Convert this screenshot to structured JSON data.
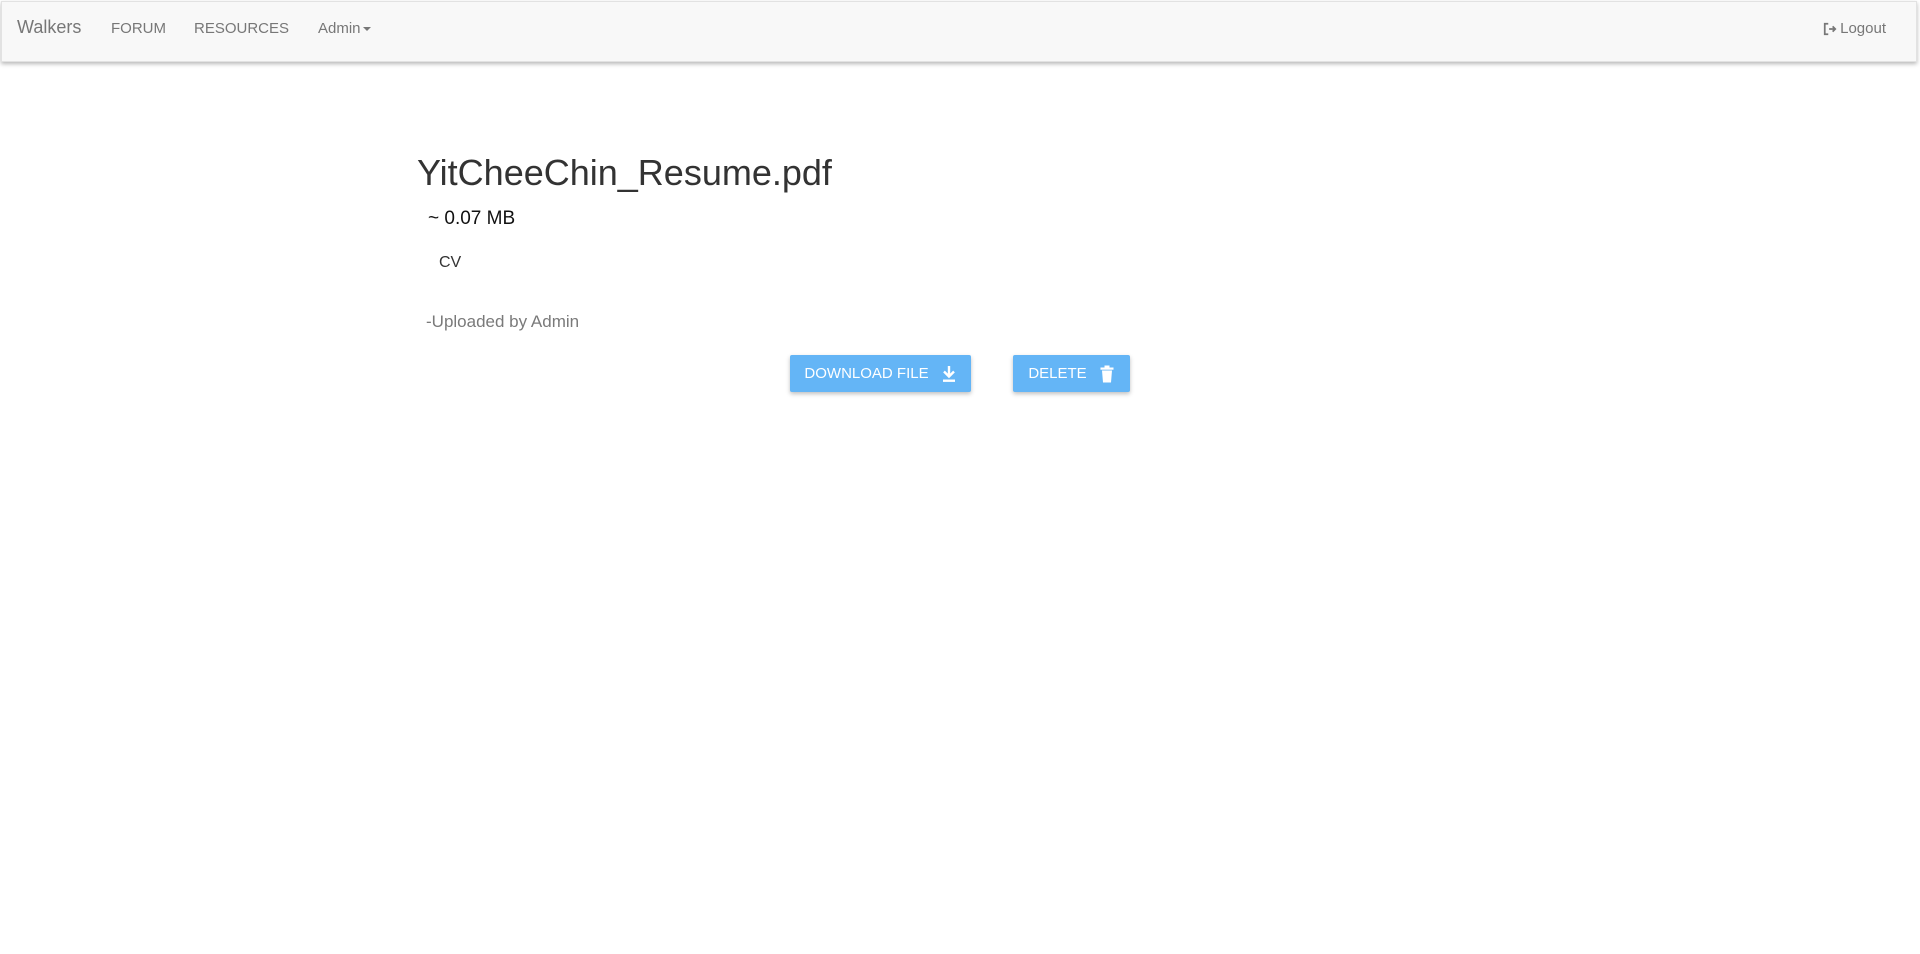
{
  "navbar": {
    "brand": "Walkers",
    "items": [
      {
        "label": "FORUM"
      },
      {
        "label": "RESOURCES"
      },
      {
        "label": "Admin"
      }
    ],
    "logout_label": "Logout",
    "logout_icon": "logout-icon"
  },
  "file": {
    "name": "YitCheeChin_Resume.pdf",
    "size": "~ 0.07 MB",
    "description": "CV",
    "uploaded_by": "-Uploaded by Admin"
  },
  "actions": {
    "download_label": "DOWNLOAD FILE",
    "download_icon": "download-icon",
    "delete_label": "DELETE",
    "delete_icon": "trash-icon"
  },
  "colors": {
    "button": "#64b5f6",
    "navbar_bg": "#f8f8f8",
    "nav_text": "#777777"
  }
}
